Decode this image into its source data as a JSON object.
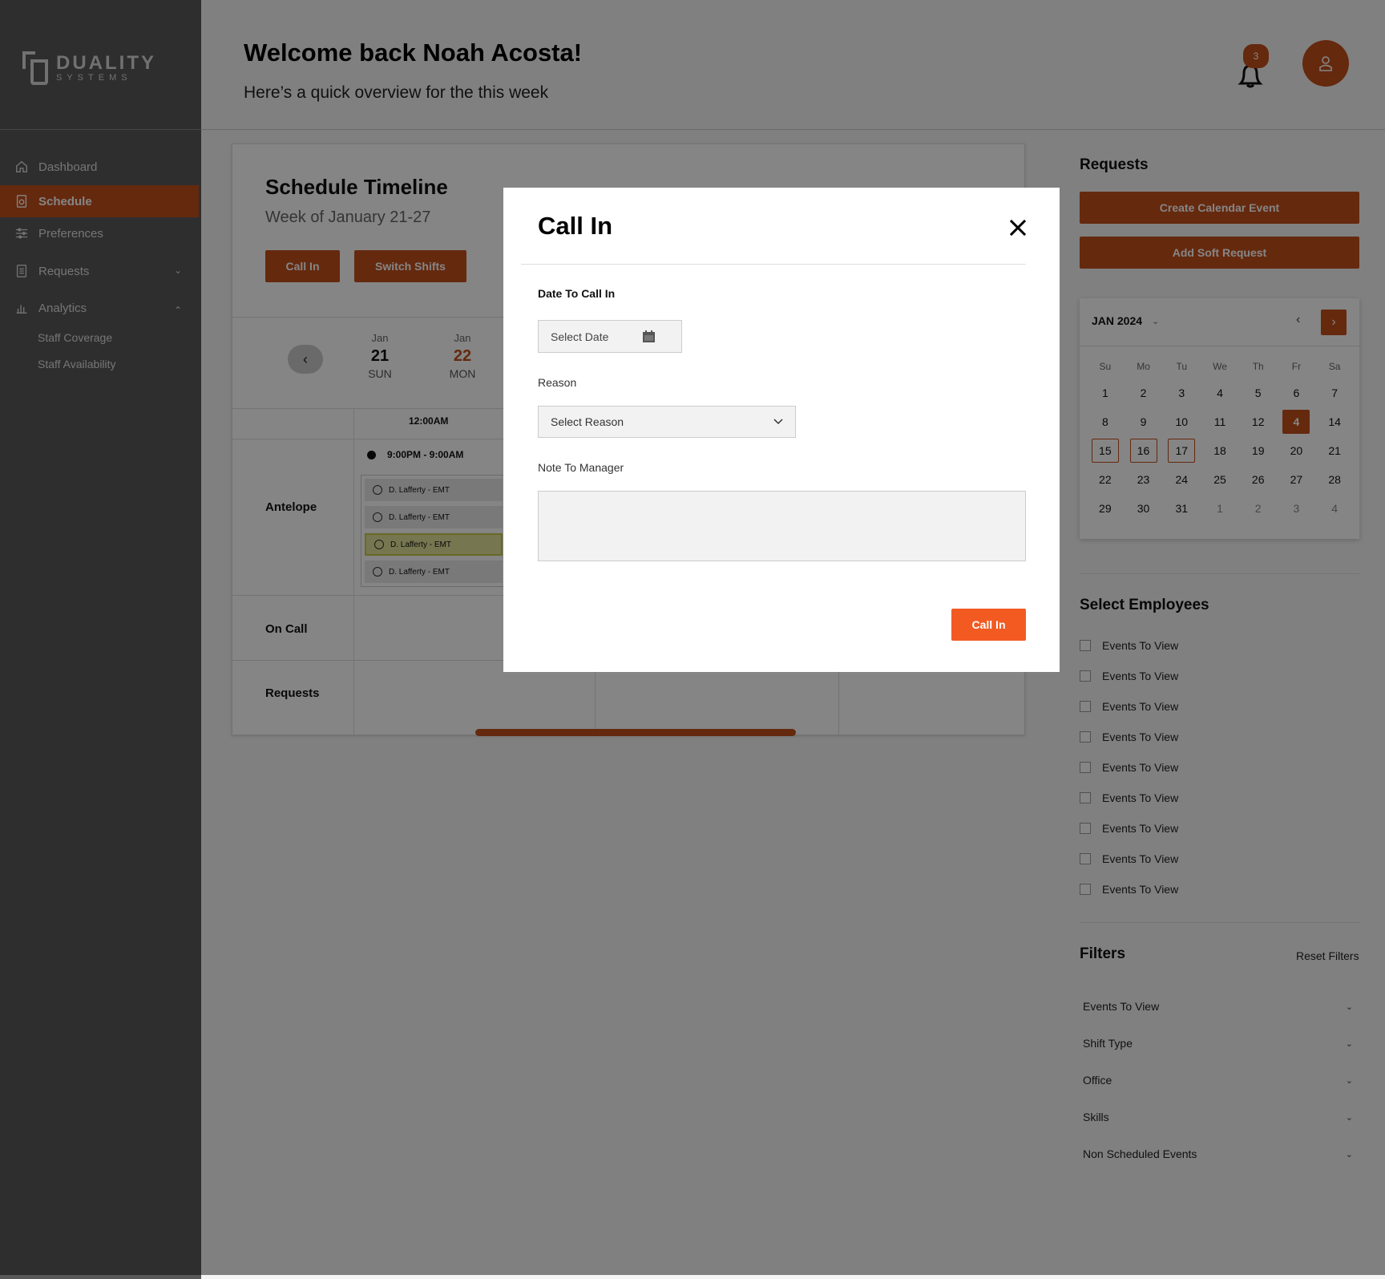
{
  "brand": {
    "name": "DUALITY",
    "tagline": "SYSTEMS"
  },
  "sidebar": {
    "items": [
      {
        "label": "Dashboard",
        "icon": "home-icon"
      },
      {
        "label": "Schedule",
        "icon": "schedule-icon"
      },
      {
        "label": "Preferences",
        "icon": "sliders-icon"
      },
      {
        "label": "Requests",
        "icon": "clipboard-icon"
      },
      {
        "label": "Analytics",
        "icon": "bar-chart-icon"
      }
    ],
    "sub_items": [
      "Staff Coverage",
      "Staff Availability"
    ]
  },
  "header": {
    "welcome": "Welcome back Noah Acosta!",
    "subtitle": "Here’s a quick overview for the this week",
    "notification_count": "3"
  },
  "schedule": {
    "title": "Schedule Timeline",
    "subtitle": "Week of January 21-27",
    "call_in_label": "Call In",
    "switch_label": "Switch Shifts",
    "days": [
      {
        "month": "Jan",
        "num": "21",
        "weekday": "SUN"
      },
      {
        "month": "Jan",
        "num": "22",
        "weekday": "MON"
      }
    ],
    "time_header": "12:00AM",
    "rows": [
      "Antelope",
      "On Call",
      "Requests"
    ],
    "shift_time": "9:00PM - 9:00AM",
    "employees": [
      "D. Lafferty - EMT",
      "D. Lafferty - EMT",
      "D. Lafferty - EMT",
      "D. Lafferty - EMT"
    ]
  },
  "requests_panel": {
    "title": "Requests",
    "create_label": "Create Calendar Event",
    "soft_label": "Add Soft Request"
  },
  "calendar": {
    "month_label": "JAN 2024",
    "weekdays": [
      "Su",
      "Mo",
      "Tu",
      "We",
      "Th",
      "Fr",
      "Sa"
    ],
    "days": [
      "1",
      "2",
      "3",
      "4",
      "5",
      "6",
      "7",
      "8",
      "9",
      "10",
      "11",
      "12",
      "4",
      "14",
      "15",
      "16",
      "17",
      "18",
      "19",
      "20",
      "21",
      "22",
      "23",
      "24",
      "25",
      "26",
      "27",
      "28",
      "29",
      "30",
      "31",
      "1",
      "2",
      "3",
      "4"
    ]
  },
  "employees_panel": {
    "title": "Select Employees",
    "items": [
      "Events To View",
      "Events To View",
      "Events To View",
      "Events To View",
      "Events To View",
      "Events To View",
      "Events To View",
      "Events To View",
      "Events To View"
    ]
  },
  "filters": {
    "title": "Filters",
    "reset_label": "Reset Filters",
    "items": [
      "Events To View",
      "Shift Type",
      "Office",
      "Skills",
      "Non Scheduled Events"
    ]
  },
  "modal": {
    "title": "Call In",
    "date_label": "Date To Call In",
    "date_placeholder": "Select Date",
    "reason_label": "Reason",
    "reason_placeholder": "Select Reason",
    "note_label": "Note To Manager",
    "submit_label": "Call In"
  },
  "colors": {
    "accent": "#c1501c",
    "accent_bright": "#f25a22",
    "sidebar": "#585858"
  }
}
